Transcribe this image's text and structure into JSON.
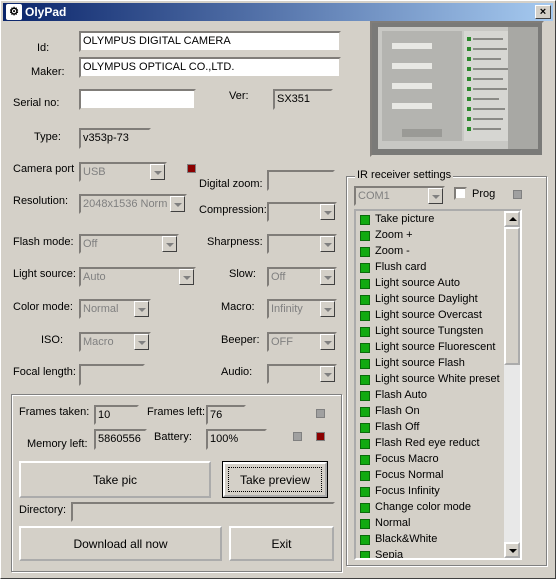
{
  "title": "OlyPad",
  "fields": {
    "id_label": "Id:",
    "id_value": "OLYMPUS DIGITAL CAMERA",
    "maker_label": "Maker:",
    "maker_value": "OLYMPUS OPTICAL CO.,LTD.",
    "serial_label": "Serial no:",
    "serial_value": "",
    "ver_label": "Ver:",
    "ver_value": "SX351",
    "type_label": "Type:",
    "type_value": "v353p-73"
  },
  "settings": {
    "camera_port_label": "Camera port",
    "camera_port_value": "USB",
    "digital_zoom_label": "Digital zoom:",
    "resolution_label": "Resolution:",
    "resolution_value": "2048x1536 Norm",
    "compression_label": "Compression:",
    "flash_mode_label": "Flash mode:",
    "flash_mode_value": "Off",
    "sharpness_label": "Sharpness:",
    "light_source_label": "Light source:",
    "light_source_value": "Auto",
    "slow_label": "Slow:",
    "slow_value": "Off",
    "color_mode_label": "Color mode:",
    "color_mode_value": "Normal",
    "macro_label": "Macro:",
    "macro_value": "Infinity",
    "iso_label": "ISO:",
    "iso_value": "Macro",
    "beeper_label": "Beeper:",
    "beeper_value": "OFF",
    "focal_length_label": "Focal length:",
    "audio_label": "Audio:"
  },
  "status": {
    "frames_taken_label": "Frames taken:",
    "frames_taken_value": "10",
    "frames_left_label": "Frames left:",
    "frames_left_value": "76",
    "memory_left_label": "Memory left:",
    "memory_left_value": "5860556",
    "battery_label": "Battery:",
    "battery_value": "100%"
  },
  "buttons": {
    "take_pic": "Take pic",
    "take_preview": "Take preview",
    "download_all": "Download all now",
    "exit": "Exit"
  },
  "directory": {
    "label": "Directory:",
    "value": ""
  },
  "ir": {
    "group_title": "IR receiver settings",
    "port_value": "COM1",
    "prog_label": "Prog",
    "items": [
      "Take picture",
      "Zoom +",
      "Zoom -",
      "Flush card",
      "Light source Auto",
      "Light source Daylight",
      "Light source Overcast",
      "Light source Tungsten",
      "Light source Fluorescent",
      "Light source Flash",
      "Light source White preset",
      "Flash Auto",
      "Flash On",
      "Flash Off",
      "Flash Red eye reduct",
      "Focus Macro",
      "Focus Normal",
      "Focus Infinity",
      "Change color mode",
      "Normal",
      "Black&White",
      "Sepia"
    ]
  },
  "colors": {
    "window_bg": "#d4d0c8",
    "titlebar_start": "#0a246a",
    "titlebar_end": "#a6caf0",
    "led_red": "#8b0000",
    "list_marker": "#11aa11"
  }
}
